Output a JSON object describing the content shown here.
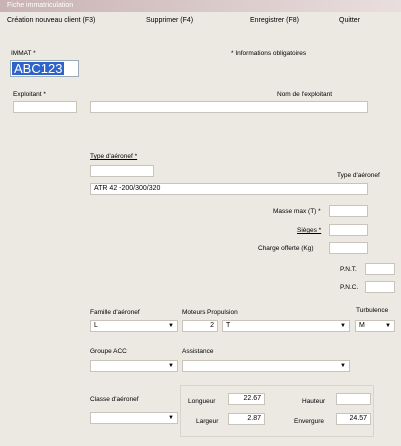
{
  "window": {
    "title": "Fiche immatriculation"
  },
  "menu": {
    "new_client": "Création nouveau client (F3)",
    "delete": "Supprimer (F4)",
    "save": "Enregistrer (F8)",
    "quit": "Quitter"
  },
  "form": {
    "immat_label": "IMMAT *",
    "mandatory_note": "* Informations obligatoires",
    "immat_value": "ABC123",
    "exploitant_label": "Exploitant *",
    "exploitant_value": "",
    "nom_exploitant_label": "Nom de l'exploitant",
    "nom_exploitant_value": "",
    "type_label": "Type d'aéronef *",
    "type_code_value": "",
    "type_right_label": "Type d'aéronef",
    "type_desc_value": "ATR 42 -200/300/320",
    "masse_label": "Masse max (T) *",
    "masse_value": "",
    "sieges_label": "Sièges *",
    "sieges_value": "",
    "charge_label": "Charge offerte (Kg)",
    "charge_value": "",
    "pnt_label": "P.N.T.",
    "pnt_value": "",
    "pnc_label": "P.N.C.",
    "pnc_value": "",
    "famille_label": "Famille d'aéronef",
    "famille_value": "L",
    "moteurs_label": "Moteurs",
    "moteurs_value": "2",
    "propulsion_label": "Propulsion",
    "propulsion_value": "T",
    "turbulence_label": "Turbulence",
    "turbulence_value": "M",
    "groupe_label": "Groupe ACC",
    "groupe_value": "",
    "assistance_label": "Assistance",
    "assistance_value": "",
    "classe_label": "Classe d'aéronef",
    "classe_value": "",
    "longueur_label": "Longueur",
    "longueur_value": "22.67",
    "hauteur_label": "Hauteur",
    "hauteur_value": "",
    "largeur_label": "Largeur",
    "largeur_value": "2.87",
    "envergure_label": "Envergure",
    "envergure_value": "24.57"
  },
  "icons": {
    "dropdown": "chevron-down-icon"
  }
}
